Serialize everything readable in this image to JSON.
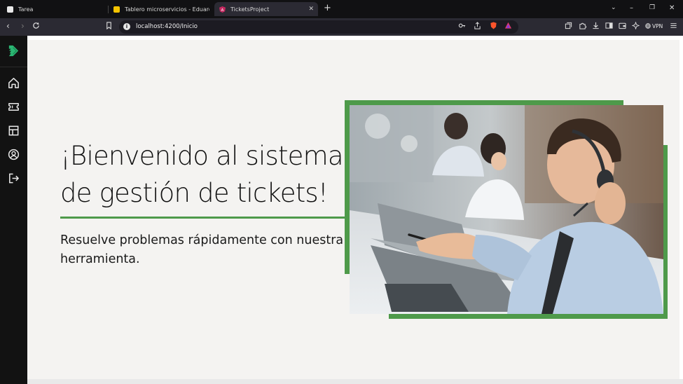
{
  "browser": {
    "tabs": [
      {
        "title": "Tarea",
        "icon": "notion-icon",
        "active": false
      },
      {
        "title": "Tablero microservicios - Eduardo Sc",
        "icon": "miro-icon",
        "active": false
      },
      {
        "title": "TicketsProject",
        "icon": "angular-icon",
        "active": true
      }
    ],
    "new_tab": "+",
    "window_controls": {
      "minimize": "–",
      "restore": "❐",
      "close": "✕",
      "tab_list": "⌄"
    },
    "url": "localhost:4200/Inicio",
    "vpn_label": "VPN"
  },
  "sidebar": {
    "items": [
      {
        "name": "logo",
        "icon": "brand-logo-icon"
      },
      {
        "name": "home",
        "icon": "home-icon"
      },
      {
        "name": "tickets",
        "icon": "ticket-icon"
      },
      {
        "name": "dashboard",
        "icon": "grid-icon"
      },
      {
        "name": "profile",
        "icon": "user-icon"
      },
      {
        "name": "logout",
        "icon": "logout-icon"
      }
    ]
  },
  "hero": {
    "headline": "¡Bienvenido al sistema de gestión de tickets!",
    "subtitle": "Resuelve problemas rápidamente con nuestra herramienta.",
    "image_alt": "Call center agent with headset"
  },
  "colors": {
    "accent": "#4e9a4a",
    "sidebar": "#121212",
    "background": "#f4f3f1",
    "brand": "#2bb673"
  }
}
